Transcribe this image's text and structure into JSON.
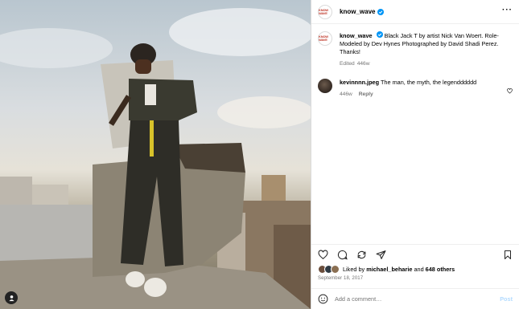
{
  "post": {
    "username": "know_wave",
    "avatar_logo": "KNOW WAVE",
    "colors": {
      "verified": "#0095f6",
      "secondary_text": "#737373",
      "post_button": "#b3dbff"
    },
    "caption": {
      "username": "know_wave",
      "text": "Black Jack T by artist Nick Van Woert. Role-Modeled by Dev Hynes Photographed by David Shadi Perez. Thanks!",
      "edited": "Edited",
      "age": "446w"
    },
    "comments": [
      {
        "username": "kevinnnn.jpeg",
        "text": "The man, the myth, the legendddddd",
        "age": "446w",
        "reply_label": "Reply"
      }
    ],
    "likes": {
      "prefix": "Liked by",
      "user": "michael_beharie",
      "joiner": "and",
      "others": "648 others"
    },
    "date": "September 18, 2017",
    "add_comment": {
      "placeholder": "Add a comment…",
      "post_label": "Post"
    },
    "icons": [
      "more-icon",
      "heart-icon",
      "comment-icon",
      "share-icon",
      "send-icon",
      "bookmark-icon",
      "emoji-icon",
      "user-tag-icon",
      "verified-badge-icon"
    ]
  }
}
